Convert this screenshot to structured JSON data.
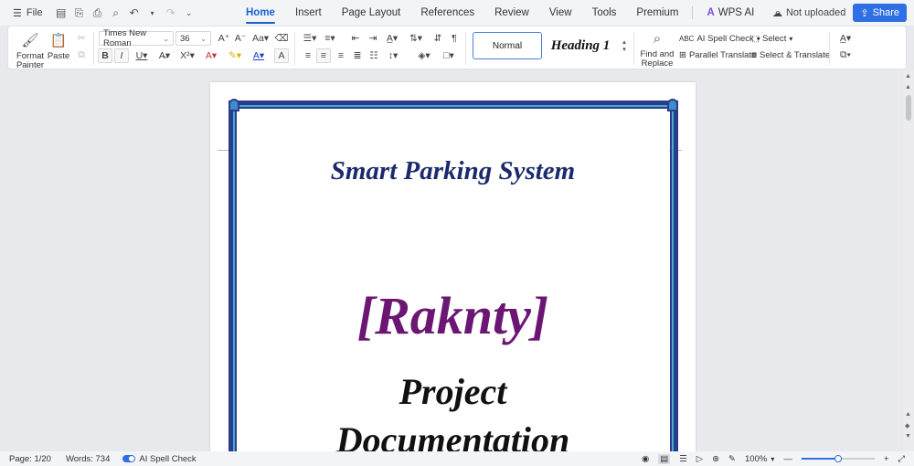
{
  "topbar": {
    "file_label": "File",
    "tabs": [
      "Home",
      "Insert",
      "Page Layout",
      "References",
      "Review",
      "View",
      "Tools",
      "Premium"
    ],
    "active_tab": "Home",
    "wps_ai_label": "WPS AI",
    "cloud_status": "Not uploaded",
    "share_label": "Share"
  },
  "ribbon": {
    "format_painter_label": "Format Painter",
    "paste_label": "Paste",
    "font_name": "Times New Roman",
    "font_size": "36",
    "styles": {
      "normal": "Normal",
      "heading1": "Heading 1"
    },
    "find_replace_label": "Find and Replace",
    "ai_spell_check_label": "AI Spell Check",
    "parallel_translate_label": "Parallel Translate",
    "select_label": "Select",
    "select_translate_label": "Select & Translate"
  },
  "document": {
    "title": "Smart Parking System",
    "brand": "[Raknty]",
    "line1": "Project",
    "line2": "Documentation"
  },
  "status": {
    "page": "Page: 1/20",
    "words": "Words: 734",
    "spell_check": "AI Spell Check",
    "zoom": "100%",
    "zoom_level": 0.5
  },
  "colors": {
    "accent": "#1a5fd0",
    "share_bg": "#2f6fe4",
    "title_color": "#1b2a6b",
    "brand_color": "#6b1673",
    "frame_color": "#2d3b8c",
    "frame_inner": "#3fb0c8"
  }
}
